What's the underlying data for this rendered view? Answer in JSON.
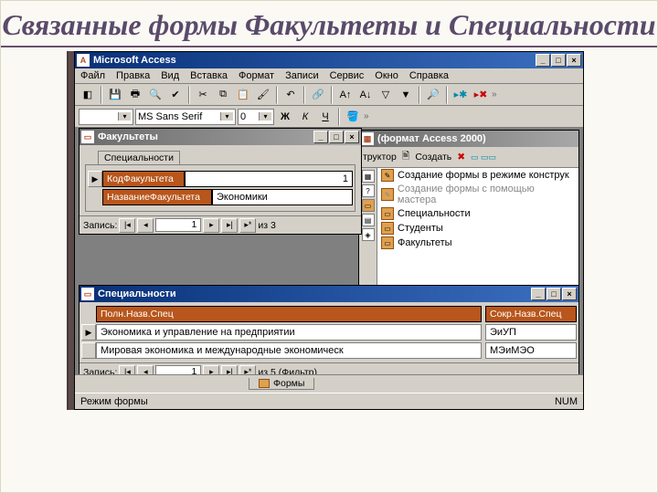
{
  "slide": {
    "title": "Связанные формы Факультеты и Специальности"
  },
  "app": {
    "title": "Microsoft Access"
  },
  "menu": {
    "file": "Файл",
    "edit": "Правка",
    "view": "Вид",
    "insert": "Вставка",
    "format": "Формат",
    "records": "Записи",
    "service": "Сервис",
    "window": "Окно",
    "help": "Справка"
  },
  "toolbar2": {
    "font": "MS Sans Serif",
    "size": "0"
  },
  "db": {
    "title": "(формат Access 2000)",
    "toolbar": {
      "constructor": "труктор",
      "create": "Создать"
    },
    "items": {
      "i0": "Создание формы в режиме конструк",
      "i1": "Создание формы с помощью мастера",
      "i2": "Специальности",
      "i3": "Студенты",
      "i4": "Факультеты"
    }
  },
  "form1": {
    "title": "Факультеты",
    "subtab": "Специальности",
    "code_lbl": "КодФакультета",
    "code_val": "1",
    "name_lbl": "НазваниеФакультета",
    "name_val": "Экономики",
    "nav": {
      "label": "Запись:",
      "pos": "1",
      "of": "из  3"
    }
  },
  "form2": {
    "title": "Специальности",
    "col1": "Полн.Назв.Спец",
    "col2": "Сокр.Назв.Спец",
    "r1c1": "Экономика и управление на предприятии",
    "r1c2": "ЭиУП",
    "r2c1": "Мировая экономика и международные экономическ",
    "r2c2": "МЭиМЭО",
    "nav": {
      "label": "Запись:",
      "pos": "1",
      "of": "из  5 (Фильтр)"
    }
  },
  "bottabs": {
    "forms": "Формы"
  },
  "status": {
    "mode": "Режим формы",
    "num": "NUM"
  }
}
